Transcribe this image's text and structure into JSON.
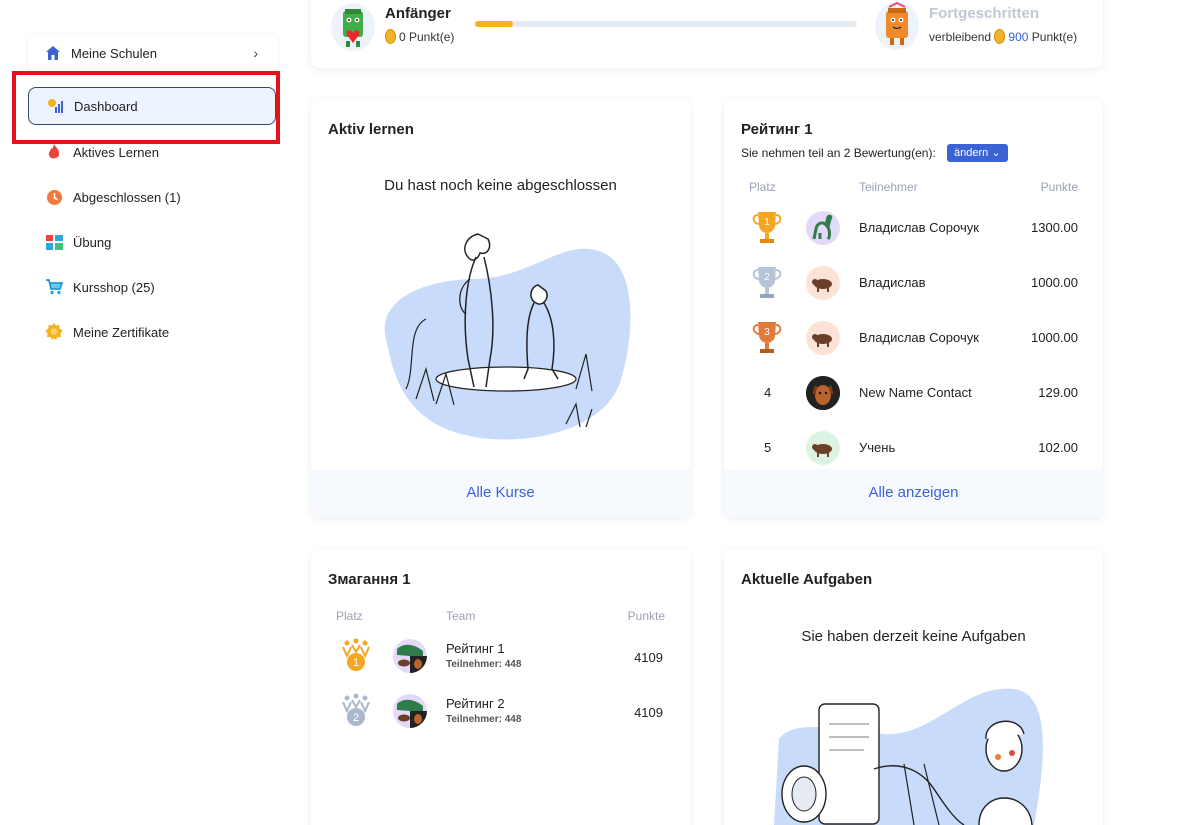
{
  "sidebar": {
    "schools_label": "Meine Schulen",
    "items": [
      {
        "label": "Dashboard",
        "icon": "dashboard-icon"
      },
      {
        "label": "Aktives Lernen",
        "icon": "flame-icon"
      },
      {
        "label": "Abgeschlossen (1)",
        "icon": "clock-icon"
      },
      {
        "label": "Übung",
        "icon": "grid-icon"
      },
      {
        "label": "Kursshop (25)",
        "icon": "cart-icon"
      },
      {
        "label": "Meine Zertifikate",
        "icon": "award-icon"
      }
    ]
  },
  "level": {
    "current_name": "Anfänger",
    "current_points": "0 Punkt(e)",
    "next_name": "Fortgeschritten",
    "remaining_prefix": "verbleibend",
    "remaining_value": "900",
    "remaining_suffix": "Punkt(e)",
    "progress": 0.1
  },
  "active": {
    "title": "Aktiv lernen",
    "empty_text": "Du hast noch keine abgeschlossen",
    "footer": "Alle Kurse"
  },
  "rating": {
    "title": "Рейтинг 1",
    "subtitle": "Sie nehmen teil an 2 Bewertung(en):",
    "change_label": "ändern",
    "headers": {
      "place": "Platz",
      "participant": "Teilnehmer",
      "points": "Punkte"
    },
    "rows": [
      {
        "place": "1",
        "name": "Владислав Сорочук",
        "points": "1300.00"
      },
      {
        "place": "2",
        "name": "Владислав",
        "points": "1000.00"
      },
      {
        "place": "3",
        "name": "Владислав Сорочук",
        "points": "1000.00"
      },
      {
        "place": "4",
        "name": "New Name Contact",
        "points": "129.00"
      },
      {
        "place": "5",
        "name": "Учень",
        "points": "102.00"
      }
    ],
    "footer": "Alle anzeigen"
  },
  "competition": {
    "title": "Змагання 1",
    "headers": {
      "place": "Platz",
      "team": "Team",
      "points": "Punkte"
    },
    "rows": [
      {
        "place": "1",
        "team": "Рейтинг 1",
        "members": "Teilnehmer: 448",
        "points": "4109"
      },
      {
        "place": "2",
        "team": "Рейтинг 2",
        "members": "Teilnehmer: 448",
        "points": "4109"
      }
    ]
  },
  "tasks": {
    "title": "Aktuelle Aufgaben",
    "empty_text": "Sie haben derzeit keine Aufgaben"
  },
  "colors": {
    "accent": "#3b63d6",
    "highlight": "#e0141a",
    "gold": "#f5a623",
    "silver": "#a9b8cc",
    "bronze": "#e07b39",
    "blob": "#c9dbfb"
  }
}
